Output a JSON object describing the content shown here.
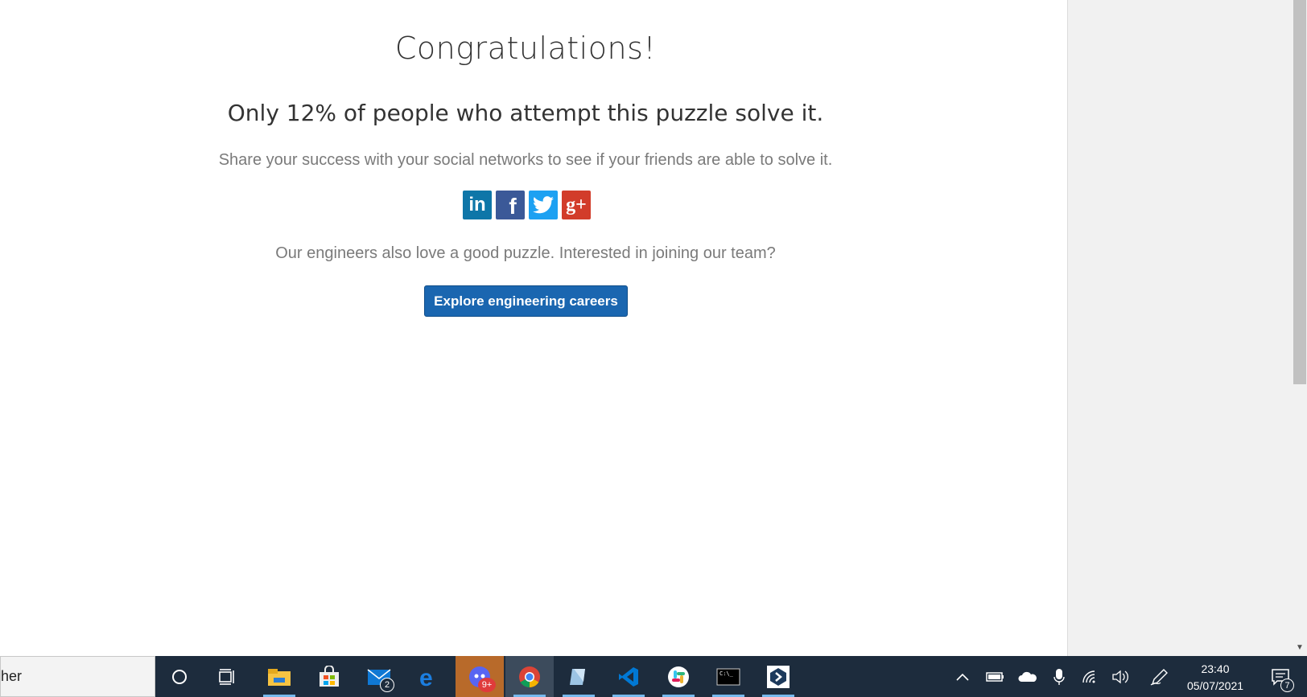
{
  "page": {
    "title": "Congratulations!",
    "subtitle": "Only 12% of people who attempt this puzzle solve it.",
    "share_text": "Share your success with your social networks to see if your friends are able to solve it.",
    "social_icons": [
      "linkedin-icon",
      "facebook-icon",
      "twitter-icon",
      "google-plus-icon"
    ],
    "social_labels": {
      "linkedin": "in",
      "facebook": "f",
      "gplus": "g+"
    },
    "engineers_text": "Our engineers also love a good puzzle. Interested in joining our team?",
    "careers_button": "Explore engineering careers"
  },
  "colors": {
    "button": "#1a66b0",
    "linkedin": "#0e76a8",
    "facebook": "#3b5998",
    "twitter": "#1da1f2",
    "gplus": "#d23c2a",
    "taskbar": "#1d2c3d"
  },
  "taskbar": {
    "search_text": "her",
    "apps": [
      {
        "name": "cortana-icon"
      },
      {
        "name": "task-view-icon"
      },
      {
        "name": "file-explorer-icon"
      },
      {
        "name": "microsoft-store-icon"
      },
      {
        "name": "mail-icon",
        "badge": "2"
      },
      {
        "name": "edge-icon"
      },
      {
        "name": "discord-icon",
        "badge": "9+"
      },
      {
        "name": "chrome-icon"
      },
      {
        "name": "notes-icon"
      },
      {
        "name": "vscode-icon"
      },
      {
        "name": "slack-icon"
      },
      {
        "name": "terminal-icon"
      },
      {
        "name": "app-icon"
      }
    ],
    "tray_icons": [
      "chevron-up-icon",
      "battery-icon",
      "onedrive-icon",
      "microphone-icon",
      "wifi-icon",
      "volume-icon",
      "pen-icon"
    ],
    "time": "23:40",
    "date": "05/07/2021",
    "notification_count": "7"
  }
}
